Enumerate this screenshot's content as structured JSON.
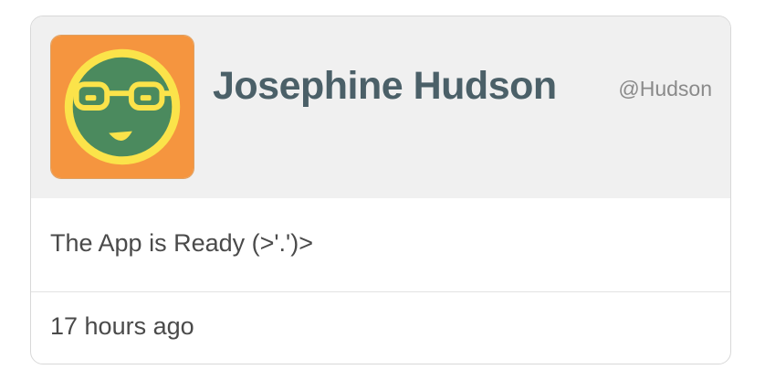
{
  "card": {
    "user": {
      "name": "Josephine Hudson",
      "handle": "@Hudson",
      "avatar_icon": "smiling-face-with-glasses-icon"
    },
    "message": "The App is Ready (>'.')>",
    "timestamp": "17 hours ago"
  },
  "colors": {
    "header_background": "#f0f0f0",
    "name_text": "#4b6068",
    "avatar_background": "#f5953f",
    "avatar_ring": "#fbe34a",
    "avatar_face": "#4b8a5e"
  }
}
